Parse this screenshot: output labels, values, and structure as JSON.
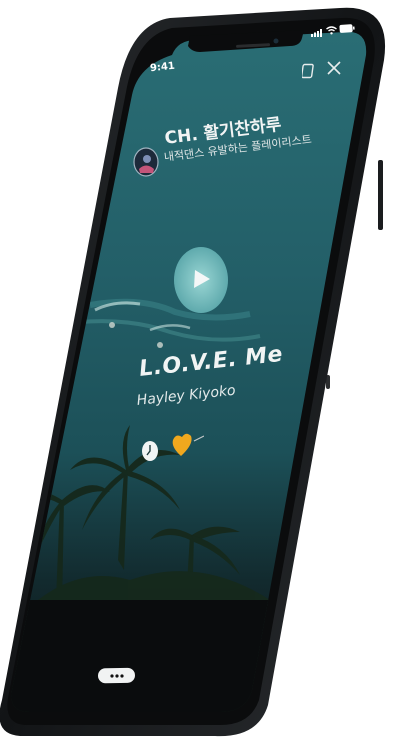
{
  "status_bar": {
    "time": "9:41"
  },
  "channel": {
    "name": "CH. 활기찬하루",
    "subtitle": "내적댄스 유발하는 플레이리스트"
  },
  "track": {
    "title": "L.O.V.E. Me",
    "artist": "Hayley Kiyoko"
  },
  "icons": {
    "play": "play-icon",
    "close": "close-icon",
    "copy": "copy-icon",
    "clock": "clock-icon",
    "heart": "heart-icon",
    "more": "more-icon"
  },
  "colors": {
    "heart": "#f0a81e",
    "screen": "#1f5d66",
    "frame": "#141618"
  }
}
